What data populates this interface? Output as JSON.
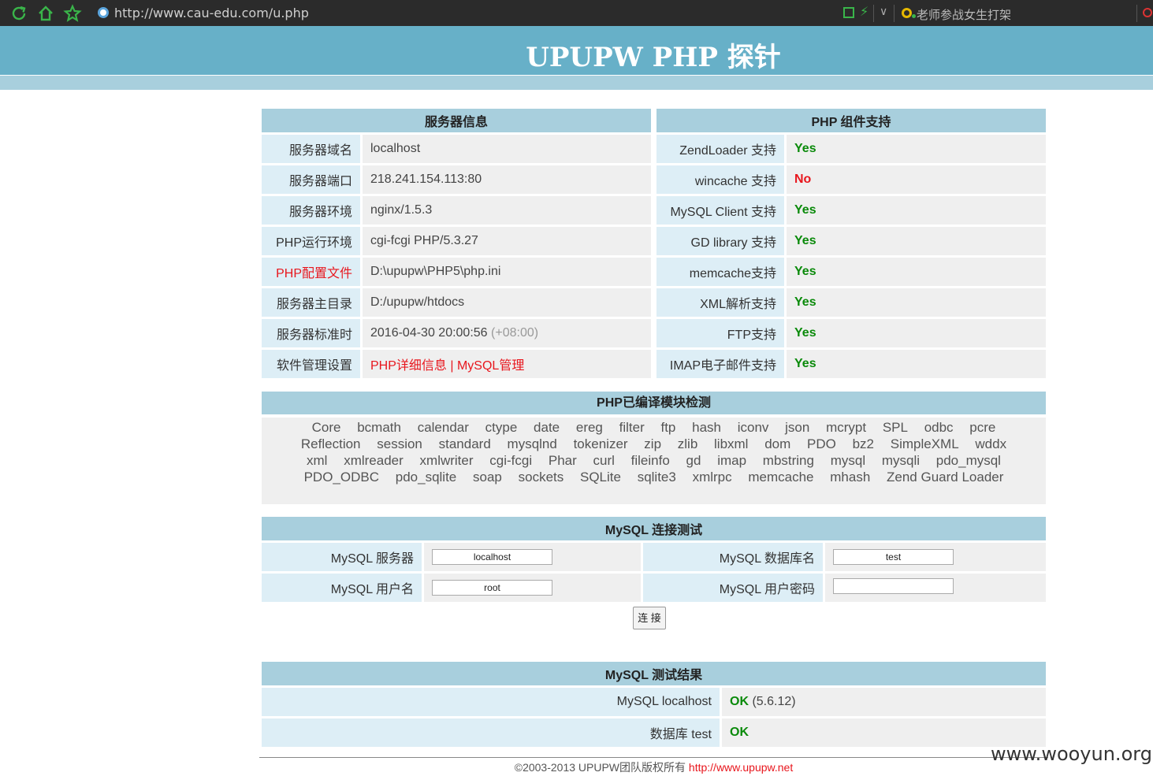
{
  "browser": {
    "url": "http://www.cau-edu.com/u.php",
    "search_text": "老师参战女生打架",
    "colors": {
      "toolbar_bg": "#2b2b2b",
      "icon_green": "#3ab54a"
    }
  },
  "header": {
    "title": "UPUPW PHP 探针",
    "banner_color": "#67b0c8"
  },
  "server_info": {
    "title": "服务器信息",
    "rows": [
      {
        "label": "服务器域名",
        "value": "localhost"
      },
      {
        "label": "服务器端口",
        "value": "218.241.154.113:80"
      },
      {
        "label": "服务器环境",
        "value": "nginx/1.5.3"
      },
      {
        "label": "PHP运行环境",
        "value": "cgi-fcgi PHP/5.3.27"
      },
      {
        "label": "PHP配置文件",
        "value": "D:\\upupw\\PHP5\\php.ini"
      },
      {
        "label": "服务器主目录",
        "value": "D:/upupw/htdocs"
      },
      {
        "label": "服务器标准时",
        "value": "2016-04-30 20:00:56",
        "extra": "(+08:00)"
      },
      {
        "label": "软件管理设置",
        "link1": "PHP详细信息",
        "sep": "|",
        "link2": "MySQL管理"
      }
    ]
  },
  "php_support": {
    "title": "PHP 组件支持",
    "rows": [
      {
        "label": "ZendLoader 支持",
        "value": "Yes"
      },
      {
        "label": "wincache 支持",
        "value": "No"
      },
      {
        "label": "MySQL Client 支持",
        "value": "Yes"
      },
      {
        "label": "GD library 支持",
        "value": "Yes"
      },
      {
        "label": "memcache支持",
        "value": "Yes"
      },
      {
        "label": "XML解析支持",
        "value": "Yes"
      },
      {
        "label": "FTP支持",
        "value": "Yes"
      },
      {
        "label": "IMAP电子邮件支持",
        "value": "Yes"
      }
    ]
  },
  "modules": {
    "title": "PHP已编译模块检测",
    "list": [
      "Core",
      "bcmath",
      "calendar",
      "ctype",
      "date",
      "ereg",
      "filter",
      "ftp",
      "hash",
      "iconv",
      "json",
      "mcrypt",
      "SPL",
      "odbc",
      "pcre",
      "Reflection",
      "session",
      "standard",
      "mysqlnd",
      "tokenizer",
      "zip",
      "zlib",
      "libxml",
      "dom",
      "PDO",
      "bz2",
      "SimpleXML",
      "wddx",
      "xml",
      "xmlreader",
      "xmlwriter",
      "cgi-fcgi",
      "Phar",
      "curl",
      "fileinfo",
      "gd",
      "imap",
      "mbstring",
      "mysql",
      "mysqli",
      "pdo_mysql",
      "PDO_ODBC",
      "pdo_sqlite",
      "soap",
      "sockets",
      "SQLite",
      "sqlite3",
      "xmlrpc",
      "memcache",
      "mhash",
      "Zend Guard Loader"
    ]
  },
  "mysql_test": {
    "title": "MySQL 连接测试",
    "server_label": "MySQL 服务器",
    "server_value": "localhost",
    "db_label": "MySQL 数据库名",
    "db_value": "test",
    "user_label": "MySQL 用户名",
    "user_value": "root",
    "pass_label": "MySQL 用户密码",
    "pass_value": "",
    "connect_label": "连 接"
  },
  "mysql_result": {
    "title": "MySQL 测试结果",
    "row1_label": "MySQL localhost",
    "row1_status": "OK",
    "row1_version": "(5.6.12)",
    "row2_label": "数据库 test",
    "row2_status": "OK"
  },
  "footer": {
    "text": "©2003-2013 UPUPW团队版权所有",
    "link": "http://www.upupw.net"
  },
  "watermark": "www.wooyun.org"
}
